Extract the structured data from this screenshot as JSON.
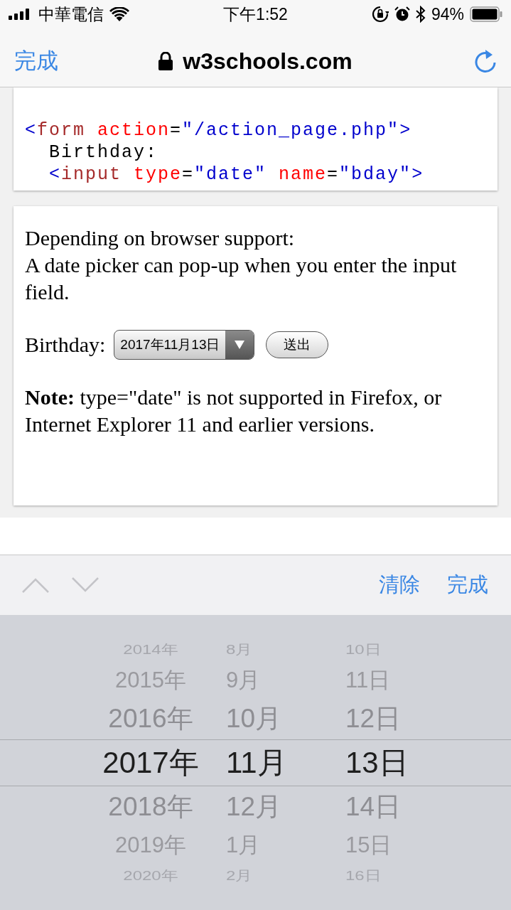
{
  "status_bar": {
    "carrier": "中華電信",
    "time": "下午1:52",
    "battery": "94%"
  },
  "nav_bar": {
    "done": "完成",
    "url": "w3schools.com"
  },
  "code_lines": [
    [
      {
        "kind": "tag",
        "text": "<"
      },
      {
        "kind": "name",
        "text": "form"
      },
      {
        "kind": "attr",
        "text": " action"
      },
      {
        "kind": "plain",
        "text": "="
      },
      {
        "kind": "value",
        "text": "\"/action_page.php\""
      },
      {
        "kind": "tag",
        "text": ">"
      }
    ],
    [
      {
        "kind": "plain",
        "text": "  Birthday:"
      }
    ],
    [
      {
        "kind": "tag",
        "text": "  <"
      },
      {
        "kind": "name",
        "text": "input"
      },
      {
        "kind": "attr",
        "text": " type"
      },
      {
        "kind": "plain",
        "text": "="
      },
      {
        "kind": "value",
        "text": "\"date\""
      },
      {
        "kind": "attr",
        "text": " name"
      },
      {
        "kind": "plain",
        "text": "="
      },
      {
        "kind": "value",
        "text": "\"bday\""
      },
      {
        "kind": "tag",
        "text": ">"
      }
    ]
  ],
  "intro": [
    "Depending on browser support:",
    "A date picker can pop-up when you enter the input field."
  ],
  "form": {
    "label": "Birthday:",
    "date_value": "2017年11月13日",
    "submit": "送出"
  },
  "note": "**Note:** type=\"date\" is not supported in Firefox, or Internet Explorer 11 and earlier versions.",
  "picker_toolbar": {
    "clear": "清除",
    "done": "完成"
  },
  "picker_rows": [
    {
      "year": "2014年",
      "month": "8月",
      "day": "10日",
      "selected": false
    },
    {
      "year": "2015年",
      "month": "9月",
      "day": "11日",
      "selected": false
    },
    {
      "year": "2016年",
      "month": "10月",
      "day": "12日",
      "selected": false
    },
    {
      "year": "2017年",
      "month": "11月",
      "day": "13日",
      "selected": true
    },
    {
      "year": "2018年",
      "month": "12月",
      "day": "14日",
      "selected": false
    },
    {
      "year": "2019年",
      "month": "1月",
      "day": "15日",
      "selected": false
    },
    {
      "year": "2020年",
      "month": "2月",
      "day": "16日",
      "selected": false
    }
  ]
}
